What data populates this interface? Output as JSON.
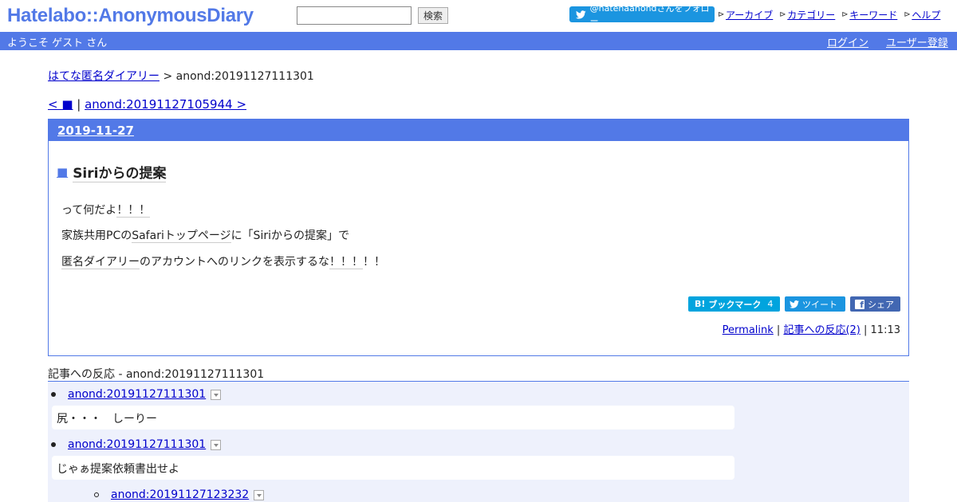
{
  "header": {
    "logo": "Hatelabo::AnonymousDiary",
    "search_value": "",
    "search_button": "検索",
    "follow_button": "@hatenaanondさんをフォロー",
    "nav": [
      "アーカイブ",
      "カテゴリー",
      "キーワード",
      "ヘルプ"
    ]
  },
  "welcome": {
    "text": "ようこそ ゲスト さん",
    "login": "ログイン",
    "register": "ユーザー登録"
  },
  "breadcrumb": {
    "home": "はてな匿名ダイアリー",
    "separator": " > ",
    "current": "anond:20191127111301"
  },
  "pager": {
    "prev": "< ■",
    "separator": " | ",
    "next": "anond:20191127105944 >"
  },
  "entry": {
    "date": "2019-11-27",
    "square": "■",
    "title": "Siriからの提案",
    "lines": [
      {
        "pre": "って何だよ",
        "kw": "！！！",
        "post": ""
      },
      {
        "pre": "家族共用PCの",
        "kw": "Safariトップページ",
        "post": "に「Siriからの提案」で"
      },
      {
        "pre": "",
        "kw": "匿名ダイアリー",
        "post": "のアカウントへのリンクを表示するな",
        "kw2": "！！！",
        "post2": "！！"
      }
    ],
    "share": {
      "hatena": "ブックマーク",
      "hatena_count": "4",
      "tweet": "ツイート",
      "facebook": "シェア"
    },
    "footer": {
      "permalink": "Permalink",
      "sep": " | ",
      "reactions": "記事への反応(2)",
      "time": "11:13"
    }
  },
  "reactions": {
    "title": "記事への反応 - anond:20191127111301",
    "items": [
      {
        "id": "anond:20191127111301",
        "body": "尻・・・　しーりー"
      },
      {
        "id": "anond:20191127111301",
        "body": "じゃぁ提案依頼書出せよ"
      },
      {
        "id": "anond:20191127123232",
        "body": ""
      }
    ]
  },
  "colors": {
    "brand": "#5279e7",
    "link": "#0000cc",
    "twitter": "#1b95e0",
    "hatena": "#00a4de",
    "facebook": "#4267b2",
    "reactions_bg": "#eef1fc"
  }
}
